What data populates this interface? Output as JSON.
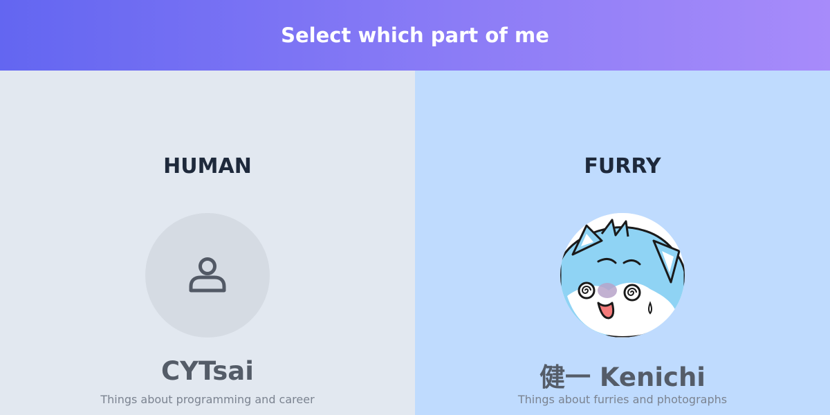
{
  "header": {
    "title": "Select which part of me"
  },
  "panels": [
    {
      "category": "HUMAN",
      "name": "CYTsai",
      "description": "Things about programming and career",
      "avatar_icon": "user-icon",
      "background": "#e2e8f0"
    },
    {
      "category": "FURRY",
      "name": "健一 Kenichi",
      "description": "Things about furries and photographs",
      "avatar_icon": "fursona-avatar",
      "background": "#bfdbfe"
    }
  ],
  "colors": {
    "header_gradient_start": "#6366f1",
    "header_gradient_end": "#a78bfa"
  }
}
